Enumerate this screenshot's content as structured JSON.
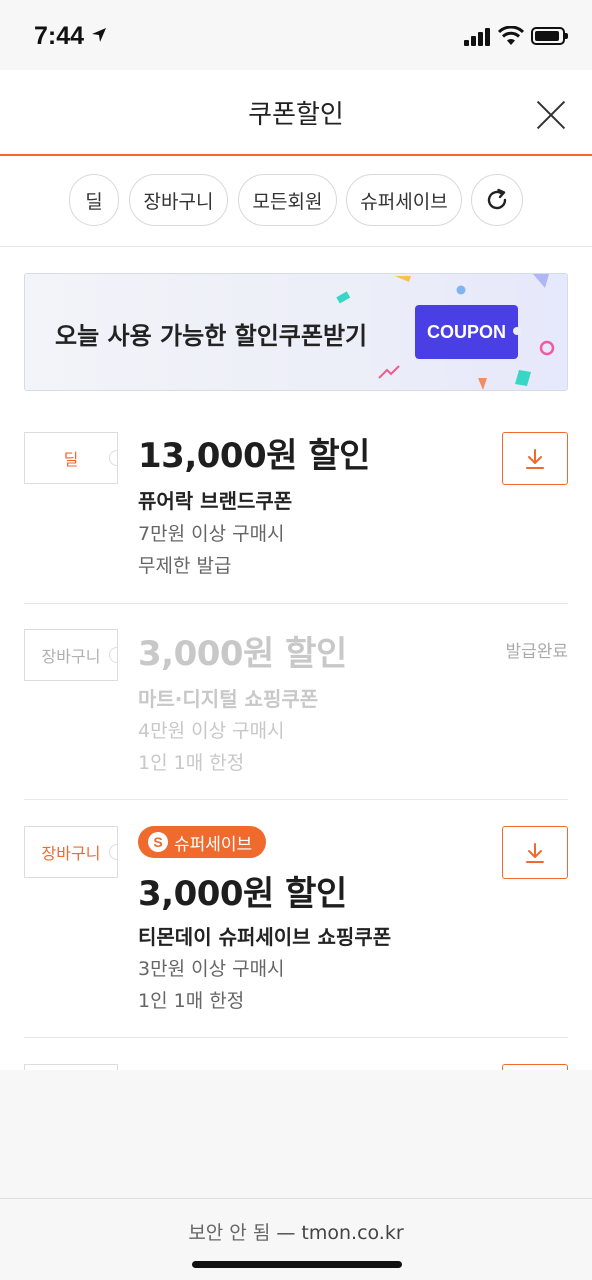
{
  "status_bar": {
    "time": "7:44"
  },
  "sheet": {
    "title": "쿠폰할인",
    "filters": [
      "딜",
      "장바구니",
      "모든회원",
      "슈퍼세이브"
    ]
  },
  "banner": {
    "text": "오늘 사용 가능한 할인쿠폰받기",
    "badge": "COUPON"
  },
  "coupons": [
    {
      "tag": "딜",
      "amount": "13,000원 할인",
      "name": "퓨어락 브랜드쿠폰",
      "condition": "7만원 이상 구매시",
      "limit": "무제한 발급",
      "state": "download"
    },
    {
      "tag": "장바구니",
      "amount": "3,000원 할인",
      "name": "마트·디지털 쇼핑쿠폰",
      "condition": "4만원 이상 구매시",
      "limit": "1인 1매 한정",
      "state": "발급완료"
    },
    {
      "tag": "장바구니",
      "badge": "슈퍼세이브",
      "badge_icon": "S",
      "amount": "3,000원 할인",
      "name": "티몬데이 슈퍼세이브 쇼핑쿠폰",
      "condition": "3만원 이상 구매시",
      "limit": "1인 1매 한정",
      "state": "download"
    }
  ],
  "url_bar": {
    "security": "보안 안 됨",
    "separator": "—",
    "domain": "tmon.co.kr"
  },
  "colors": {
    "accent": "#f06a2e",
    "coupon_badge": "#4a3fe4"
  }
}
